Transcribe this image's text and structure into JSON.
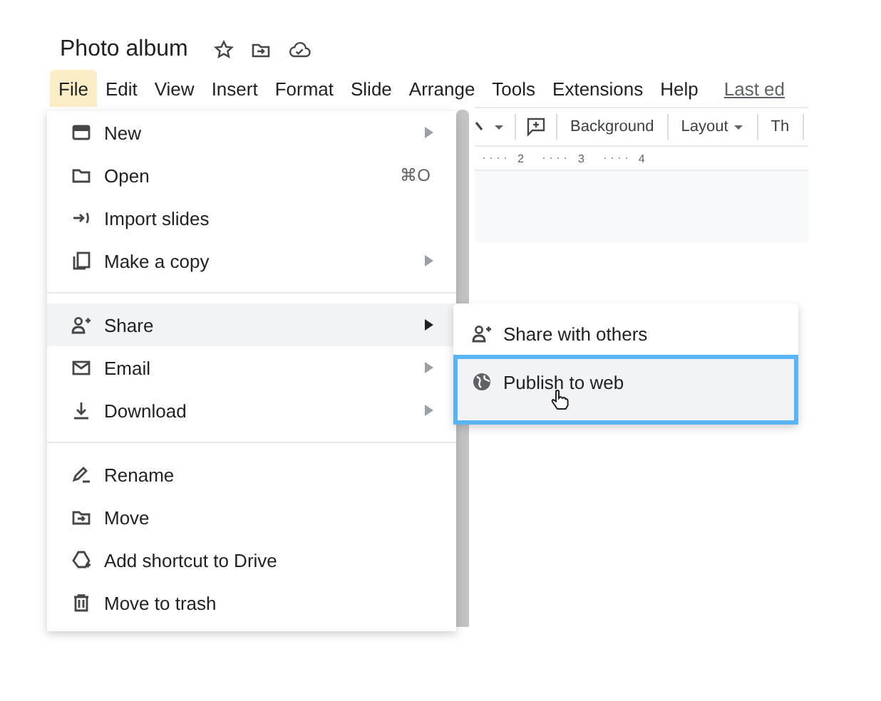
{
  "document": {
    "title": "Photo album"
  },
  "menubar": {
    "items": [
      {
        "label": "File",
        "selected": true
      },
      {
        "label": "Edit",
        "selected": false
      },
      {
        "label": "View",
        "selected": false
      },
      {
        "label": "Insert",
        "selected": false
      },
      {
        "label": "Format",
        "selected": false
      },
      {
        "label": "Slide",
        "selected": false
      },
      {
        "label": "Arrange",
        "selected": false
      },
      {
        "label": "Tools",
        "selected": false
      },
      {
        "label": "Extensions",
        "selected": false
      },
      {
        "label": "Help",
        "selected": false
      }
    ],
    "last_edit": "Last ed"
  },
  "toolbar": {
    "buttons": [
      {
        "label": "Background",
        "kind": "text"
      },
      {
        "label": "Layout",
        "kind": "dropdown"
      },
      {
        "label": "Th",
        "kind": "text"
      }
    ]
  },
  "ruler": {
    "marks": [
      "2",
      "3",
      "4"
    ]
  },
  "file_menu": {
    "sections": [
      {
        "items": [
          {
            "label": "New",
            "submenu": true,
            "highlighted": false
          },
          {
            "label": "Open",
            "shortcut": "⌘O",
            "submenu": false,
            "highlighted": false
          },
          {
            "label": "Import slides",
            "submenu": false,
            "highlighted": false
          },
          {
            "label": "Make a copy",
            "submenu": true,
            "highlighted": false
          }
        ]
      },
      {
        "items": [
          {
            "label": "Share",
            "submenu": true,
            "highlighted": true
          },
          {
            "label": "Email",
            "submenu": true,
            "highlighted": false
          },
          {
            "label": "Download",
            "submenu": true,
            "highlighted": false
          }
        ]
      },
      {
        "items": [
          {
            "label": "Rename",
            "submenu": false,
            "highlighted": false
          },
          {
            "label": "Move",
            "submenu": false,
            "highlighted": false
          },
          {
            "label": "Add shortcut to Drive",
            "submenu": false,
            "highlighted": false
          },
          {
            "label": "Move to trash",
            "submenu": false,
            "highlighted": false
          }
        ]
      }
    ]
  },
  "share_submenu": {
    "items": [
      {
        "label": "Share with others",
        "selected": false
      },
      {
        "label": "Publish to web",
        "selected": true
      }
    ]
  }
}
